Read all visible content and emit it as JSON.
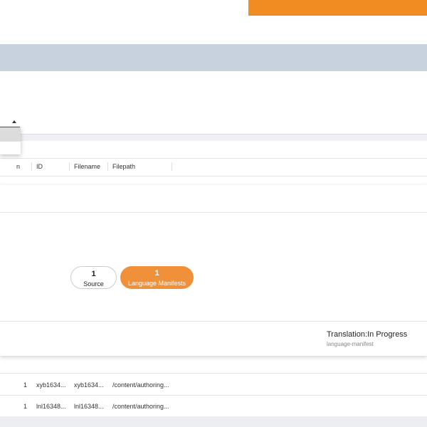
{
  "background_table": {
    "columns": [
      "n",
      "ID",
      "Filename",
      "Filepath"
    ]
  },
  "foreground": {
    "summary": [
      {
        "count": "1",
        "label": "Source"
      },
      {
        "count": "1",
        "label": "Language Manifests"
      }
    ],
    "status": {
      "title": "Translation:In Progress",
      "subtitle": "language-manifest"
    }
  },
  "rows": [
    {
      "count": "1",
      "id": "xyb1634...",
      "filename": "xyb1634...",
      "filepath": "/content/authoring..."
    },
    {
      "count": "1",
      "id": "lnl16348...",
      "filename": "lnl16348...",
      "filepath": "/content/authoring..."
    }
  ],
  "colors": {
    "accent": "#f08c21",
    "blue_band": "#c8d2de",
    "pill_active": "#f0913a"
  }
}
